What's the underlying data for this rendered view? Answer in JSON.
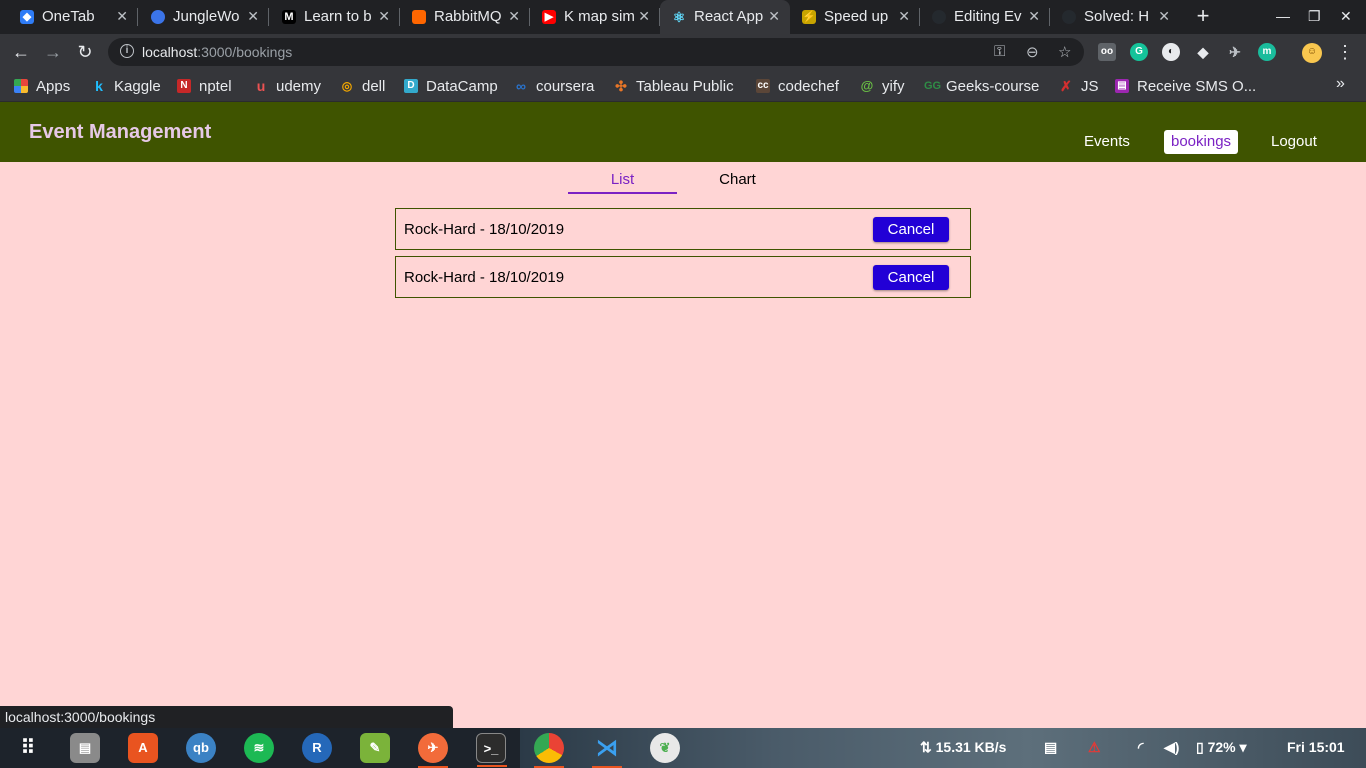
{
  "browser": {
    "tabs": [
      {
        "title": "OneTab",
        "icon": "onetab-icon",
        "color": "#2f7cf6"
      },
      {
        "title": "JungleWo",
        "icon": "junglewo-icon",
        "color": "#3b74e8"
      },
      {
        "title": "Learn to b",
        "icon": "medium-icon",
        "color": "#000000"
      },
      {
        "title": "RabbitMQ",
        "icon": "rabbitmq-icon",
        "color": "#ff6600"
      },
      {
        "title": "K map sim",
        "icon": "youtube-icon",
        "color": "#ff0000"
      },
      {
        "title": "React App",
        "icon": "react-icon",
        "color": "#61dafb"
      },
      {
        "title": "Speed up",
        "icon": "speed-icon",
        "color": "#c8a400"
      },
      {
        "title": "Editing Ev",
        "icon": "github-icon",
        "color": "#24292e"
      },
      {
        "title": "Solved: H",
        "icon": "github-icon",
        "color": "#24292e"
      }
    ],
    "url_host": "localhost",
    "url_path": ":3000/bookings",
    "bookmarks": [
      {
        "label": "Apps",
        "icon": "apps-grid-icon",
        "color": "#e8453c"
      },
      {
        "label": "Kaggle",
        "icon": "kaggle-icon",
        "color": "#20beff"
      },
      {
        "label": "nptel",
        "icon": "nptel-icon",
        "color": "#c62828"
      },
      {
        "label": "udemy",
        "icon": "udemy-icon",
        "color": "#ec5252"
      },
      {
        "label": "dell",
        "icon": "dell-icon",
        "color": "#f0a500"
      },
      {
        "label": "DataCamp",
        "icon": "datacamp-icon",
        "color": "#33aacc"
      },
      {
        "label": "coursera",
        "icon": "coursera-icon",
        "color": "#2a73cc"
      },
      {
        "label": "Tableau Public",
        "icon": "tableau-icon",
        "color": "#e97627"
      },
      {
        "label": "codechef",
        "icon": "codechef-icon",
        "color": "#5b4638"
      },
      {
        "label": "yify",
        "icon": "yify-icon",
        "color": "#6ac045"
      },
      {
        "label": "Geeks-course",
        "icon": "geeks-icon",
        "color": "#2f8d46"
      },
      {
        "label": "JS",
        "icon": "js-icon",
        "color": "#d32f2f"
      },
      {
        "label": "Receive SMS O...",
        "icon": "sms-icon",
        "color": "#9c27b0"
      }
    ]
  },
  "app": {
    "brand": "Event Management",
    "nav": [
      "Events",
      "bookings",
      "Logout"
    ],
    "tabs": [
      "List",
      "Chart"
    ],
    "bookings": [
      {
        "text": "Rock-Hard - 18/10/2019",
        "action": "Cancel"
      },
      {
        "text": "Rock-Hard - 18/10/2019",
        "action": "Cancel"
      }
    ]
  },
  "status_url": "localhost:3000/bookings",
  "taskbar": {
    "network_speed": "15.31 KB/s",
    "battery": "72%",
    "clock": "Fri 15:01"
  }
}
